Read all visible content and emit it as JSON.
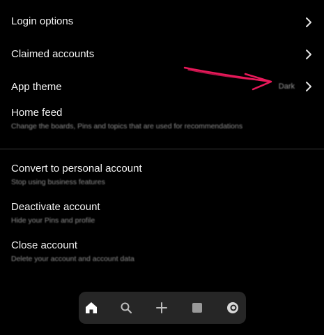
{
  "settings": {
    "login_options": {
      "label": "Login options"
    },
    "claimed_accounts": {
      "label": "Claimed accounts"
    },
    "app_theme": {
      "label": "App theme",
      "value": "Dark"
    },
    "home_feed": {
      "label": "Home feed",
      "description": "Change the boards, Pins and topics that are used for recommendations"
    }
  },
  "account_actions": {
    "convert": {
      "label": "Convert to personal account",
      "description": "Stop using business features"
    },
    "deactivate": {
      "label": "Deactivate account",
      "description": "Hide your Pins and profile"
    },
    "close": {
      "label": "Close account",
      "description": "Delete your account and account data"
    }
  },
  "annotation": {
    "arrow_color": "#e8195a"
  },
  "bottom_nav": {
    "items": [
      {
        "icon": "home-icon",
        "active": true
      },
      {
        "icon": "search-icon",
        "active": false
      },
      {
        "icon": "plus-icon",
        "active": false
      },
      {
        "icon": "messages-icon",
        "active": false
      },
      {
        "icon": "profile-icon",
        "active": false
      }
    ]
  },
  "colors": {
    "background": "#000000",
    "nav_background": "#262626",
    "text": "#f2f2f2",
    "subtext": "#8e8e8e"
  }
}
